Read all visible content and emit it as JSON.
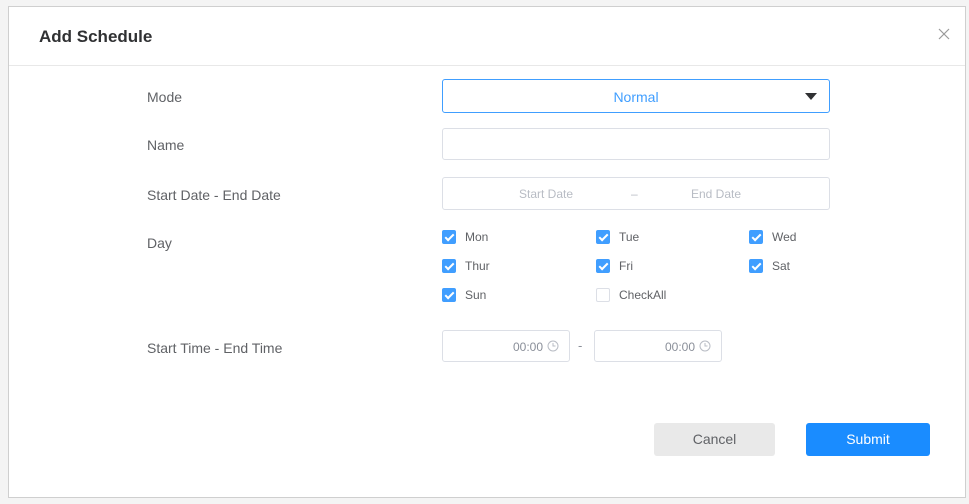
{
  "dialog": {
    "title": "Add Schedule",
    "close_icon": "close-icon"
  },
  "form": {
    "mode": {
      "label": "Mode",
      "value": "Normal"
    },
    "name": {
      "label": "Name",
      "value": "",
      "placeholder": ""
    },
    "date_range": {
      "label": "Start Date - End Date",
      "start_placeholder": "Start Date",
      "separator": "–",
      "end_placeholder": "End Date"
    },
    "day": {
      "label": "Day",
      "options": [
        {
          "label": "Mon",
          "checked": true
        },
        {
          "label": "Tue",
          "checked": true
        },
        {
          "label": "Wed",
          "checked": true
        },
        {
          "label": "Thur",
          "checked": true
        },
        {
          "label": "Fri",
          "checked": true
        },
        {
          "label": "Sat",
          "checked": true
        },
        {
          "label": "Sun",
          "checked": true
        },
        {
          "label": "CheckAll",
          "checked": false
        }
      ]
    },
    "time_range": {
      "label": "Start Time - End Time",
      "start": "00:00",
      "separator": "-",
      "end": "00:00"
    }
  },
  "footer": {
    "cancel_label": "Cancel",
    "submit_label": "Submit"
  },
  "colors": {
    "accent": "#409eff",
    "submit": "#1a8cff"
  }
}
